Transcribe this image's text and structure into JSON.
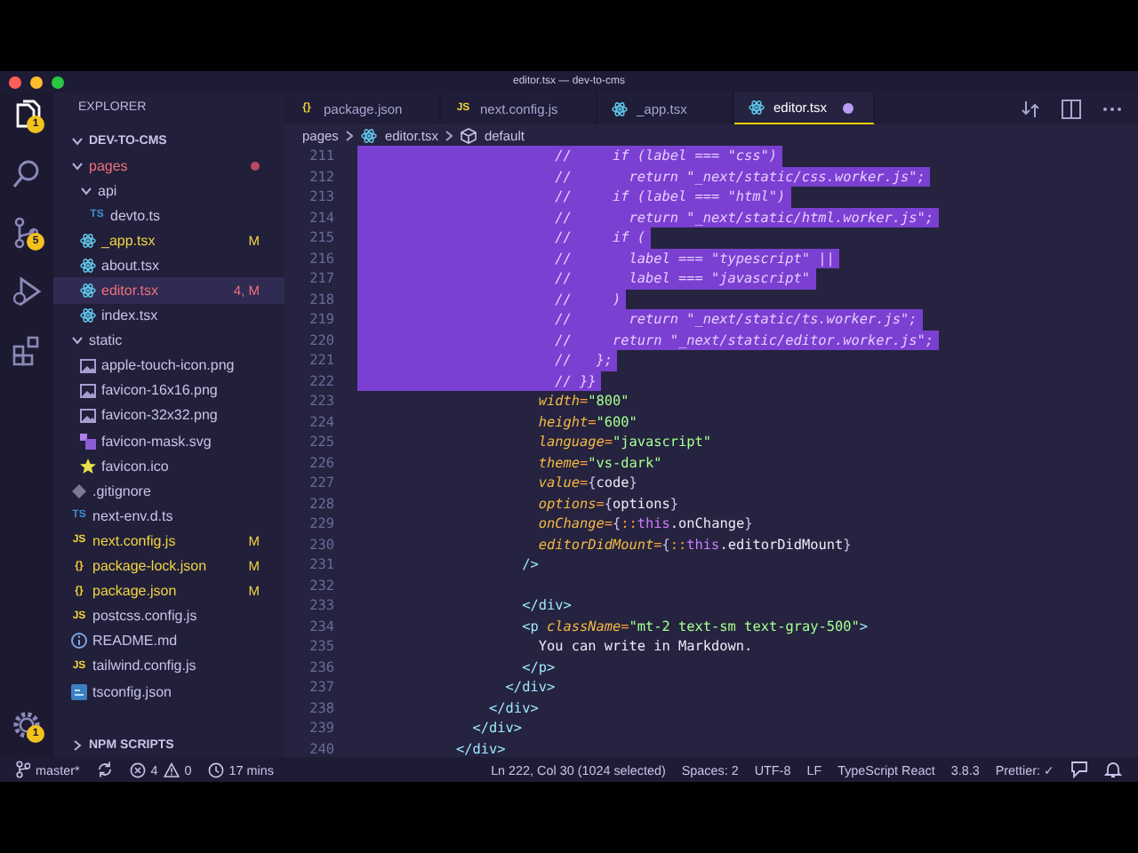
{
  "window": {
    "title": "editor.tsx — dev-to-cms"
  },
  "activity_bar": {
    "items": [
      {
        "kind": "files",
        "selected": true,
        "badge": "1"
      },
      {
        "kind": "search",
        "selected": false
      },
      {
        "kind": "source-control",
        "selected": false,
        "badge": "5"
      },
      {
        "kind": "run",
        "selected": false
      },
      {
        "kind": "extensions",
        "selected": false
      }
    ],
    "manage": {
      "badge": "1"
    }
  },
  "sidebar": {
    "title": "EXPLORER",
    "root": {
      "label": "DEV-TO-CMS",
      "expanded": true
    },
    "tree": [
      {
        "kind": "folder",
        "label": "pages",
        "has_errors": true,
        "expanded": true,
        "selected": false,
        "children": [
          {
            "kind": "folder",
            "label": "api",
            "modified": false,
            "has_errors": false,
            "expanded": true,
            "selected": false,
            "children": [
              {
                "kind": "ts",
                "label": "devto.ts",
                "glyph": "TS",
                "modified": false,
                "has_errors": false,
                "selected": false
              }
            ]
          },
          {
            "kind": "react",
            "label": "_app.tsx",
            "modified": true,
            "has_errors": false,
            "badge": "M",
            "selected": false
          },
          {
            "kind": "react",
            "label": "about.tsx",
            "modified": false,
            "has_errors": false,
            "selected": false
          },
          {
            "kind": "react",
            "label": "editor.tsx",
            "has_errors": true,
            "badge": "4, M",
            "selected": true
          },
          {
            "kind": "react",
            "label": "index.tsx",
            "modified": false,
            "has_errors": false,
            "selected": false
          }
        ]
      },
      {
        "kind": "folder",
        "label": "static",
        "modified": false,
        "has_errors": false,
        "expanded": true,
        "selected": false,
        "children": [
          {
            "kind": "image",
            "label": "apple-touch-icon.png",
            "modified": false,
            "has_errors": false,
            "selected": false
          },
          {
            "kind": "image",
            "label": "favicon-16x16.png",
            "modified": false,
            "has_errors": false,
            "selected": false
          },
          {
            "kind": "image",
            "label": "favicon-32x32.png",
            "modified": false,
            "has_errors": false,
            "selected": false
          },
          {
            "kind": "svg",
            "label": "favicon-mask.svg",
            "modified": false,
            "has_errors": false,
            "selected": false
          },
          {
            "kind": "star",
            "label": "favicon.ico",
            "modified": false,
            "has_errors": false,
            "selected": false
          }
        ]
      },
      {
        "kind": "git",
        "label": ".gitignore",
        "modified": false,
        "has_errors": false,
        "selected": false
      },
      {
        "kind": "ts",
        "label": "next-env.d.ts",
        "glyph": "TS",
        "modified": false,
        "has_errors": false,
        "selected": false
      },
      {
        "kind": "js",
        "label": "next.config.js",
        "glyph": "JS",
        "modified": true,
        "has_errors": false,
        "badge": "M",
        "selected": false
      },
      {
        "kind": "json",
        "label": "package-lock.json",
        "glyph": "{}",
        "modified": true,
        "has_errors": false,
        "badge": "M",
        "selected": false
      },
      {
        "kind": "json",
        "label": "package.json",
        "glyph": "{}",
        "modified": true,
        "has_errors": false,
        "badge": "M",
        "selected": false
      },
      {
        "kind": "js",
        "label": "postcss.config.js",
        "glyph": "JS",
        "modified": false,
        "has_errors": false,
        "selected": false
      },
      {
        "kind": "info",
        "label": "README.md",
        "modified": false,
        "has_errors": false,
        "selected": false
      },
      {
        "kind": "js",
        "label": "tailwind.config.js",
        "glyph": "JS",
        "modified": false,
        "has_errors": false,
        "selected": false
      },
      {
        "kind": "tsconfig",
        "label": "tsconfig.json",
        "modified": false,
        "has_errors": false,
        "selected": false
      }
    ],
    "npm_scripts": {
      "label": "NPM SCRIPTS",
      "expanded": false
    }
  },
  "tabs": [
    {
      "label": "package.json",
      "kind": "json",
      "glyph": "{}",
      "selected": false,
      "dirty": false
    },
    {
      "label": "next.config.js",
      "kind": "js",
      "glyph": "JS",
      "selected": false,
      "dirty": false
    },
    {
      "label": "_app.tsx",
      "kind": "react",
      "selected": false,
      "dirty": false
    },
    {
      "label": "editor.tsx",
      "kind": "react",
      "selected": true,
      "dirty": true
    }
  ],
  "breadcrumb": [
    {
      "label": "pages"
    },
    {
      "label": "editor.tsx",
      "kind": "react"
    },
    {
      "label": "default",
      "kind": "symbol"
    }
  ],
  "editor": {
    "lines": [
      {
        "number": "211",
        "selected": true,
        "tokens": [
          {
            "kind": "comment",
            "text": "                        //     if (label === \"css\")"
          }
        ]
      },
      {
        "number": "212",
        "selected": true,
        "tokens": [
          {
            "kind": "comment",
            "text": "                        //       return \"_next/static/css.worker.js\";"
          }
        ]
      },
      {
        "number": "213",
        "selected": true,
        "tokens": [
          {
            "kind": "comment",
            "text": "                        //     if (label === \"html\")"
          }
        ]
      },
      {
        "number": "214",
        "selected": true,
        "tokens": [
          {
            "kind": "comment",
            "text": "                        //       return \"_next/static/html.worker.js\";"
          }
        ]
      },
      {
        "number": "215",
        "selected": true,
        "tokens": [
          {
            "kind": "comment",
            "text": "                        //     if ("
          }
        ]
      },
      {
        "number": "216",
        "selected": true,
        "tokens": [
          {
            "kind": "comment",
            "text": "                        //       label === \"typescript\" ||"
          }
        ]
      },
      {
        "number": "217",
        "selected": true,
        "tokens": [
          {
            "kind": "comment",
            "text": "                        //       label === \"javascript\""
          }
        ]
      },
      {
        "number": "218",
        "selected": true,
        "tokens": [
          {
            "kind": "comment",
            "text": "                        //     )"
          }
        ]
      },
      {
        "number": "219",
        "selected": true,
        "tokens": [
          {
            "kind": "comment",
            "text": "                        //       return \"_next/static/ts.worker.js\";"
          }
        ]
      },
      {
        "number": "220",
        "selected": true,
        "tokens": [
          {
            "kind": "comment",
            "text": "                        //     return \"_next/static/editor.worker.js\";"
          }
        ]
      },
      {
        "number": "221",
        "selected": true,
        "tokens": [
          {
            "kind": "comment",
            "text": "                        //   };"
          }
        ]
      },
      {
        "number": "222",
        "selected": true,
        "tokens": [
          {
            "kind": "comment",
            "text": "                        // }}"
          }
        ]
      },
      {
        "number": "223",
        "selected": false,
        "tokens": [
          {
            "kind": "attr",
            "text": "                      width"
          },
          {
            "kind": "punct",
            "text": "="
          },
          {
            "kind": "string",
            "text": "\"800\""
          }
        ]
      },
      {
        "number": "224",
        "selected": false,
        "tokens": [
          {
            "kind": "attr",
            "text": "                      height"
          },
          {
            "kind": "punct",
            "text": "="
          },
          {
            "kind": "string",
            "text": "\"600\""
          }
        ]
      },
      {
        "number": "225",
        "selected": false,
        "tokens": [
          {
            "kind": "attr",
            "text": "                      language"
          },
          {
            "kind": "punct",
            "text": "="
          },
          {
            "kind": "string",
            "text": "\"javascript\""
          }
        ]
      },
      {
        "number": "226",
        "selected": false,
        "tokens": [
          {
            "kind": "attr",
            "text": "                      theme"
          },
          {
            "kind": "punct",
            "text": "="
          },
          {
            "kind": "string",
            "text": "\"vs-dark\""
          }
        ]
      },
      {
        "number": "227",
        "selected": false,
        "tokens": [
          {
            "kind": "attr",
            "text": "                      value"
          },
          {
            "kind": "punct",
            "text": "="
          },
          {
            "kind": "brace",
            "text": "{"
          },
          {
            "kind": "plain",
            "text": "code"
          },
          {
            "kind": "brace",
            "text": "}"
          }
        ]
      },
      {
        "number": "228",
        "selected": false,
        "tokens": [
          {
            "kind": "attr",
            "text": "                      options"
          },
          {
            "kind": "punct",
            "text": "="
          },
          {
            "kind": "brace",
            "text": "{"
          },
          {
            "kind": "plain",
            "text": "options"
          },
          {
            "kind": "brace",
            "text": "}"
          }
        ]
      },
      {
        "number": "229",
        "selected": false,
        "tokens": [
          {
            "kind": "attr",
            "text": "                      onChange"
          },
          {
            "kind": "punct",
            "text": "="
          },
          {
            "kind": "brace",
            "text": "{"
          },
          {
            "kind": "punct",
            "text": "::"
          },
          {
            "kind": "keyword",
            "text": "this"
          },
          {
            "kind": "plain",
            "text": ".onChange"
          },
          {
            "kind": "brace",
            "text": "}"
          }
        ]
      },
      {
        "number": "230",
        "selected": false,
        "tokens": [
          {
            "kind": "attr",
            "text": "                      editorDidMount"
          },
          {
            "kind": "punct",
            "text": "="
          },
          {
            "kind": "brace",
            "text": "{"
          },
          {
            "kind": "punct",
            "text": "::"
          },
          {
            "kind": "keyword",
            "text": "this"
          },
          {
            "kind": "plain",
            "text": ".editorDidMount"
          },
          {
            "kind": "brace",
            "text": "}"
          }
        ]
      },
      {
        "number": "231",
        "selected": false,
        "tokens": [
          {
            "kind": "tag",
            "text": "                    />"
          }
        ]
      },
      {
        "number": "232",
        "selected": false
      },
      {
        "number": "233",
        "selected": false,
        "tokens": [
          {
            "kind": "tag",
            "text": "                    </div>"
          }
        ]
      },
      {
        "number": "234",
        "selected": false,
        "tokens": [
          {
            "kind": "tag",
            "text": "                    <p"
          },
          {
            "kind": "attr",
            "text": " className"
          },
          {
            "kind": "punct",
            "text": "="
          },
          {
            "kind": "string",
            "text": "\"mt-2 text-sm text-gray-500\""
          },
          {
            "kind": "tag",
            "text": ">"
          }
        ]
      },
      {
        "number": "235",
        "selected": false,
        "tokens": [
          {
            "kind": "plain",
            "text": "                      You can write in Markdown."
          }
        ]
      },
      {
        "number": "236",
        "selected": false,
        "tokens": [
          {
            "kind": "tag",
            "text": "                    </p>"
          }
        ]
      },
      {
        "number": "237",
        "selected": false,
        "tokens": [
          {
            "kind": "tag",
            "text": "                  </div>"
          }
        ]
      },
      {
        "number": "238",
        "selected": false,
        "tokens": [
          {
            "kind": "tag",
            "text": "                </div>"
          }
        ]
      },
      {
        "number": "239",
        "selected": false,
        "tokens": [
          {
            "kind": "tag",
            "text": "              </div>"
          }
        ]
      },
      {
        "number": "240",
        "selected": false,
        "tokens": [
          {
            "kind": "tag",
            "text": "            </div>"
          }
        ]
      }
    ]
  },
  "status_bar": {
    "branch": "master*",
    "errors": "4",
    "warnings": "0",
    "time": "17 mins",
    "position": "Ln 222, Col 30 (1024 selected)",
    "indentation": "Spaces: 2",
    "encoding": "UTF-8",
    "line_ending": "LF",
    "language": "TypeScript React",
    "version": "3.8.3",
    "formatter": "Prettier: ✓"
  }
}
